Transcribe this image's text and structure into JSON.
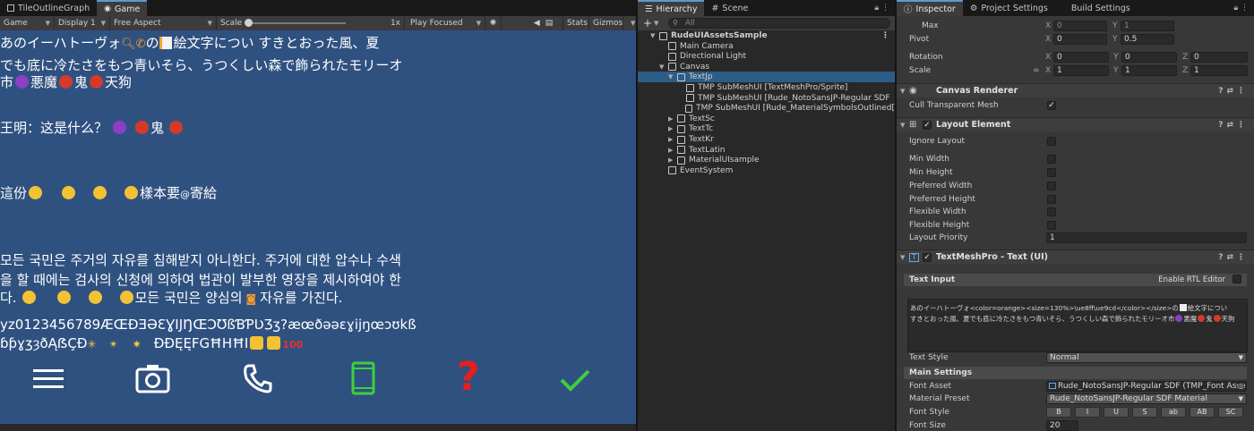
{
  "game_tabs": {
    "tab1": "TileOutlineGraph",
    "tab2": "Game"
  },
  "game_toolbar": {
    "view": "Game",
    "display": "Display 1",
    "aspect": "Free Aspect",
    "scale_label": "Scale",
    "scale_value": "1x",
    "play_mode": "Play Focused",
    "stats": "Stats",
    "gizmos": "Gizmos"
  },
  "game_text": {
    "jp1_a": "あのイーハトーヴォ",
    "jp1_b": "の",
    "jp1_c": "絵文字につい すきとおった風、夏",
    "jp2": "でも底に冷たさをもつ青いそら、うつくしい森で飾られたモリーオ",
    "jp3_a": "市",
    "jp3_b": "悪魔",
    "jp3_c": "鬼",
    "jp3_d": "天狗",
    "sc_a": "王明：这是什么？",
    "sc_b": "鬼",
    "tc_a": "這份",
    "tc_b": "樣本要",
    "tc_c": "寄給",
    "kr1": "모든 국민은 주거의 자유를 침해받지 아니한다. 주거에 대한 압수나 수색",
    "kr2": "을 할 때에는 검사의 신청에 의하여 법관이 발부한 영장을 제시하여야 한",
    "kr3_a": "다.",
    "kr3_b": "모든 국민은 양심의",
    "kr3_c": "자유를 가진다.",
    "latin1": "yz0123456789ÆŒÐƎƏƐƔIJŊŒƆƱßƁƤƲƷʒ?æœðǝəɛɣijŋœɔʊkß",
    "latin2": "ɓƥɣʒȝðĄẞÇÐ",
    "latin2_b": "ÐĐĘĘFGĦHĦI"
  },
  "hierarchy": {
    "tabs": {
      "hierarchy": "Hierarchy",
      "scene": "Scene"
    },
    "add": "+",
    "search_placeholder": "All",
    "items": [
      {
        "label": "RudeUIAssetsSample"
      },
      {
        "label": "Main Camera"
      },
      {
        "label": "Directional Light"
      },
      {
        "label": "Canvas"
      },
      {
        "label": "TextJp"
      },
      {
        "label": "TMP SubMeshUI [TextMeshPro/Sprite]"
      },
      {
        "label": "TMP SubMeshUI [Rude_NotoSansJP-Regular SDF"
      },
      {
        "label": "TMP SubMeshUI [Rude_MaterialSymbolsOutlined["
      },
      {
        "label": "TextSc"
      },
      {
        "label": "TextTc"
      },
      {
        "label": "TextKr"
      },
      {
        "label": "TextLatin"
      },
      {
        "label": "MaterialUIsample"
      },
      {
        "label": "EventSystem"
      }
    ]
  },
  "inspector": {
    "tabs": {
      "inspector": "Inspector",
      "project": "Project Settings",
      "build": "Build Settings"
    },
    "max": {
      "label": "Max",
      "x": "0",
      "y": "1"
    },
    "pivot": {
      "label": "Pivot",
      "x": "0",
      "y": "0.5"
    },
    "rotation": {
      "label": "Rotation",
      "x": "0",
      "y": "0",
      "z": "0"
    },
    "scale": {
      "label": "Scale",
      "x": "1",
      "y": "1",
      "z": "1"
    },
    "axes": {
      "x": "X",
      "y": "Y",
      "z": "Z"
    },
    "canvas_renderer": {
      "title": "Canvas Renderer",
      "cull": "Cull Transparent Mesh"
    },
    "layout_element": {
      "title": "Layout Element",
      "ignore": "Ignore Layout",
      "min_w": "Min Width",
      "min_h": "Min Height",
      "pref_w": "Preferred Width",
      "pref_h": "Preferred Height",
      "flex_w": "Flexible Width",
      "flex_h": "Flexible Height",
      "priority": "Layout Priority",
      "priority_value": "1"
    },
    "tmp": {
      "title": "TextMeshPro - Text (UI)",
      "text_input": "Text Input",
      "rtl": "Enable RTL Editor",
      "text1": "あのイーハトーヴォ<color=orange><size=130%>\\ue8ff\\ue9cd</color></size>の",
      "text1_b": "絵文字につい",
      "text2": "すきとおった風、夏でも底に冷たさをもつ青いそら、うつくしい森で飾られたモリーオ市",
      "text2_b": "悪魔",
      "text2_c": "鬼",
      "text2_d": "天狗",
      "text_style": "Text Style",
      "text_style_value": "Normal",
      "main_settings": "Main Settings",
      "font_asset": "Font Asset",
      "font_asset_value": "Rude_NotoSansJP-Regular SDF (TMP_Font Asse",
      "material_preset": "Material Preset",
      "material_preset_value": "Rude_NotoSansJP-Regular SDF Material",
      "font_style": "Font Style",
      "styles": [
        "B",
        "I",
        "U",
        "S",
        "ab",
        "AB",
        "SC"
      ],
      "font_size": "Font Size",
      "font_size_value": "20"
    }
  },
  "colors": {
    "game_bg": "#2f5180",
    "selection": "#2c5d87",
    "icon_green": "#3cd13c",
    "icon_red": "#e61e1e"
  }
}
